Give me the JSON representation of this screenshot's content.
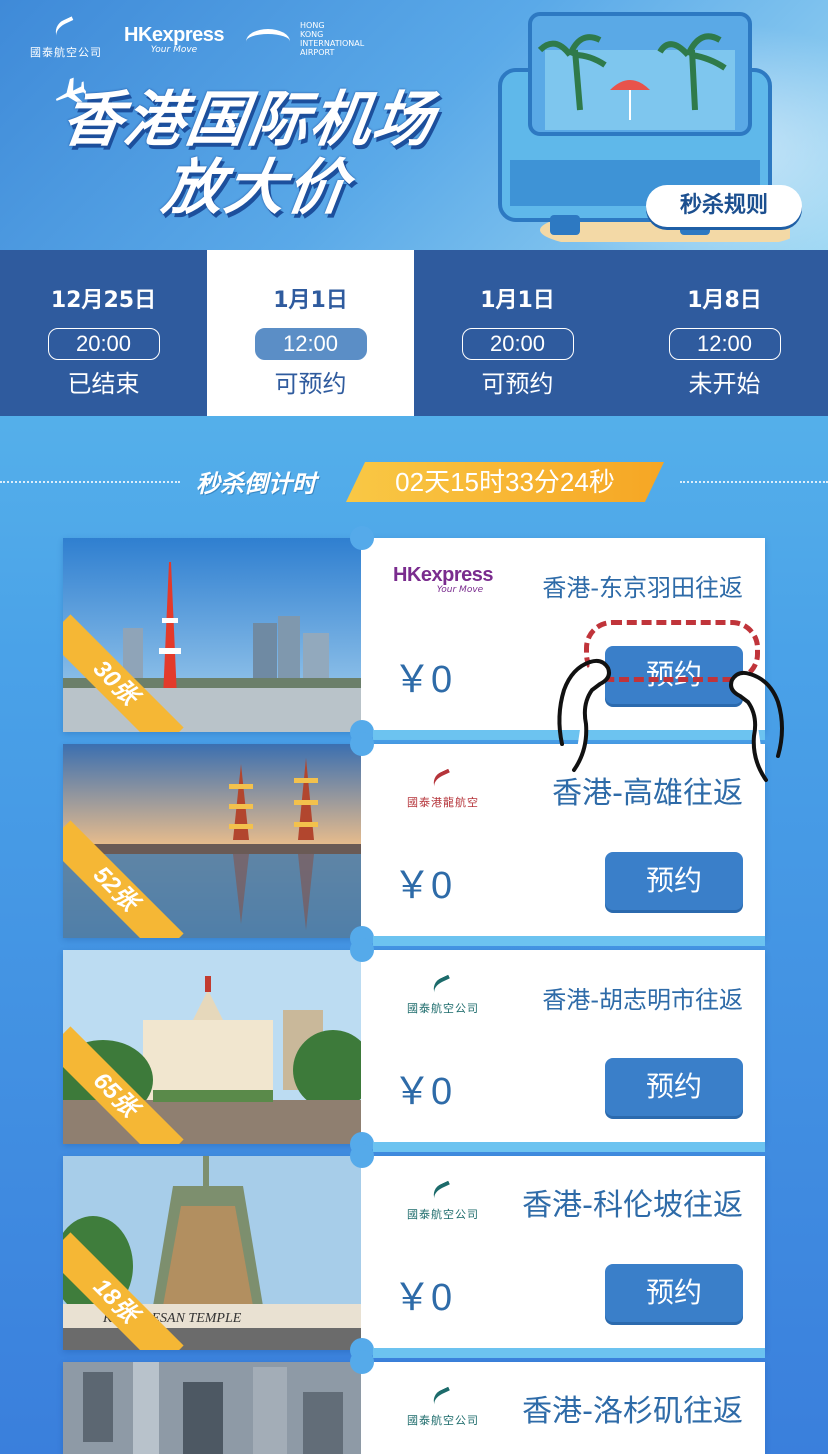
{
  "banner": {
    "logo1": "國泰航空公司",
    "logo2_main": "HKexpress",
    "logo2_sub": "Your Move",
    "logo3": "HONG KONG INTERNATIONAL AIRPORT",
    "title_line1": "香港国际机场",
    "title_line2": "放大价",
    "rules_button": "秒杀规则"
  },
  "tabs": [
    {
      "date": "12月25日",
      "time": "20:00",
      "status": "已结束",
      "active": false
    },
    {
      "date": "1月1日",
      "time": "12:00",
      "status": "可预约",
      "active": true
    },
    {
      "date": "1月1日",
      "time": "20:00",
      "status": "可预约",
      "active": false
    },
    {
      "date": "1月8日",
      "time": "12:00",
      "status": "未开始",
      "active": false
    }
  ],
  "countdown": {
    "label": "秒杀倒计时",
    "value": "02天15时33分24秒"
  },
  "deals": [
    {
      "airline": "HKexpress",
      "airline_sub": "Your Move",
      "route": "香港-东京羽田往返",
      "price": "￥0",
      "book_label": "预约",
      "tickets": "30张"
    },
    {
      "airline": "國泰港龍航空",
      "route": "香港-高雄往返",
      "price": "￥0",
      "book_label": "预约",
      "tickets": "52张"
    },
    {
      "airline": "國泰航空公司",
      "route": "香港-胡志明市往返",
      "price": "￥0",
      "book_label": "预约",
      "tickets": "65张"
    },
    {
      "airline": "國泰航空公司",
      "route": "香港-科伦坡往返",
      "price": "￥0",
      "book_label": "预约",
      "tickets": "18张",
      "photo_sign": "KATHIRESAN TEMPLE"
    },
    {
      "airline": "國泰航空公司",
      "route": "香港-洛杉矶往返"
    }
  ],
  "colors": {
    "tab_bar": "#2f5b9e",
    "book_button": "#3a7fc9",
    "ribbon": "#f5b735",
    "route_text": "#2e6ba8"
  }
}
